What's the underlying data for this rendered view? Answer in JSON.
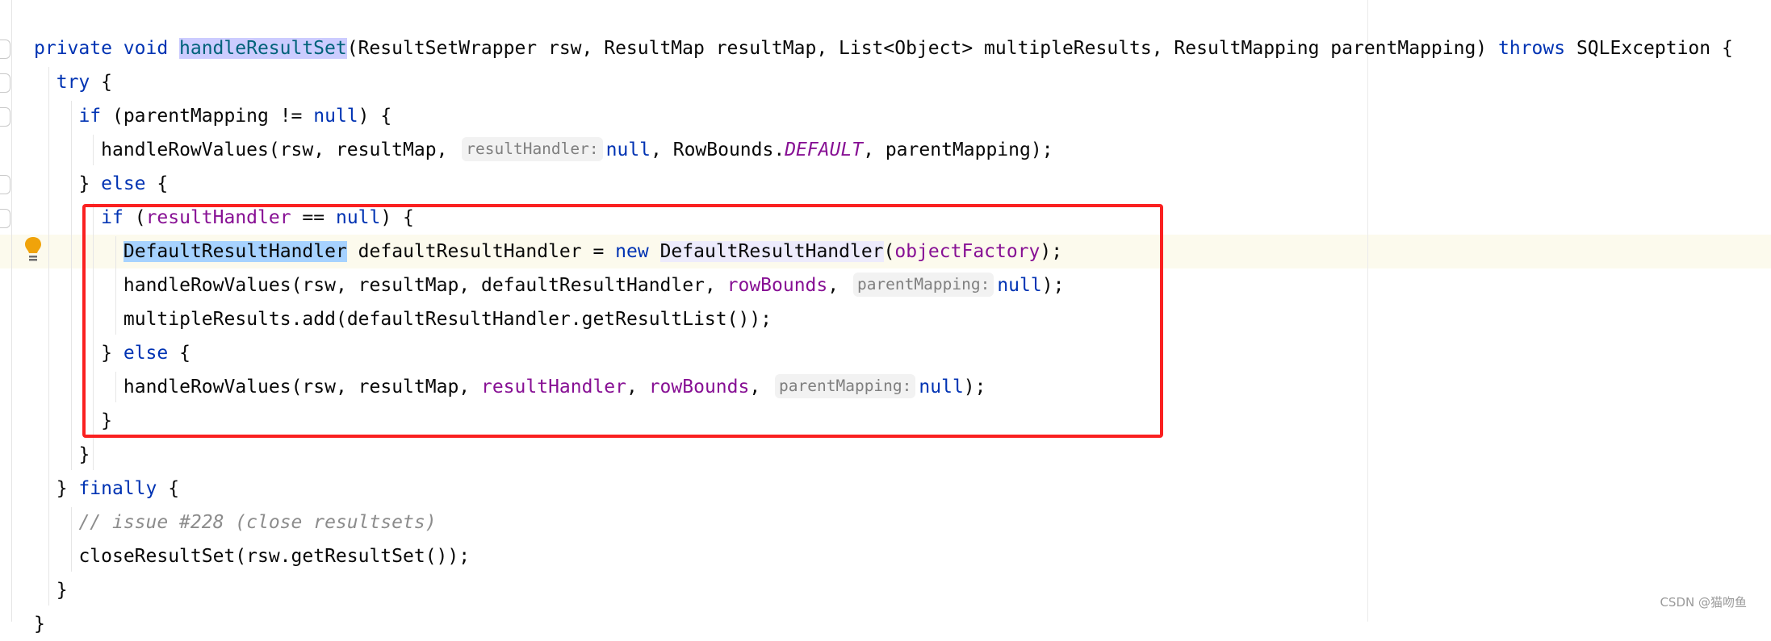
{
  "editor": {
    "lines": [
      {
        "indent": 0,
        "tokens": [
          {
            "t": "private void ",
            "c": "kw"
          },
          {
            "t": "handleResultSet",
            "c": "decl"
          },
          {
            "t": "(ResultSetWrapper rsw, ResultMap resultMap, List<Object> multipleResults, ResultMapping parentMapping) "
          },
          {
            "t": "throws",
            "c": "kw"
          },
          {
            "t": " SQLException {"
          }
        ]
      },
      {
        "indent": 1,
        "tokens": [
          {
            "t": "try",
            "c": "kw"
          },
          {
            "t": " {"
          }
        ]
      },
      {
        "indent": 2,
        "tokens": [
          {
            "t": "if",
            "c": "kw"
          },
          {
            "t": " (parentMapping != "
          },
          {
            "t": "null",
            "c": "kw"
          },
          {
            "t": ") {"
          }
        ]
      },
      {
        "indent": 3,
        "tokens": [
          {
            "t": "handleRowValues(rsw, resultMap, "
          },
          {
            "t": "resultHandler:",
            "c": "hint"
          },
          {
            "t": "null",
            "c": "kw"
          },
          {
            "t": ", RowBounds."
          },
          {
            "t": "DEFAULT",
            "c": "static"
          },
          {
            "t": ", parentMapping);"
          }
        ]
      },
      {
        "indent": 2,
        "tokens": [
          {
            "t": "} "
          },
          {
            "t": "else",
            "c": "kw"
          },
          {
            "t": " {"
          }
        ]
      },
      {
        "indent": 3,
        "tokens": [
          {
            "t": "if",
            "c": "kw"
          },
          {
            "t": " ("
          },
          {
            "t": "resultHandler",
            "c": "field"
          },
          {
            "t": " == "
          },
          {
            "t": "null",
            "c": "kw"
          },
          {
            "t": ") {"
          }
        ]
      },
      {
        "indent": 4,
        "tokens": [
          {
            "t": "DefaultResultHandler",
            "c": "sel"
          },
          {
            "t": " defaultResultHandler = "
          },
          {
            "t": "new",
            "c": "kw"
          },
          {
            "t": " "
          },
          {
            "t": "DefaultResultHandler",
            "c": "ref"
          },
          {
            "t": "("
          },
          {
            "t": "objectFactory",
            "c": "field"
          },
          {
            "t": ");"
          }
        ]
      },
      {
        "indent": 4,
        "tokens": [
          {
            "t": "handleRowValues(rsw, resultMap, defaultResultHandler, "
          },
          {
            "t": "rowBounds",
            "c": "field"
          },
          {
            "t": ", "
          },
          {
            "t": "parentMapping:",
            "c": "hint"
          },
          {
            "t": "null",
            "c": "kw"
          },
          {
            "t": ");"
          }
        ]
      },
      {
        "indent": 4,
        "tokens": [
          {
            "t": "multipleResults.add(defaultResultHandler.getResultList());"
          }
        ]
      },
      {
        "indent": 3,
        "tokens": [
          {
            "t": "} "
          },
          {
            "t": "else",
            "c": "kw"
          },
          {
            "t": " {"
          }
        ]
      },
      {
        "indent": 4,
        "tokens": [
          {
            "t": "handleRowValues(rsw, resultMap, "
          },
          {
            "t": "resultHandler",
            "c": "field"
          },
          {
            "t": ", "
          },
          {
            "t": "rowBounds",
            "c": "field"
          },
          {
            "t": ", "
          },
          {
            "t": "parentMapping:",
            "c": "hint"
          },
          {
            "t": "null",
            "c": "kw"
          },
          {
            "t": ");"
          }
        ]
      },
      {
        "indent": 3,
        "tokens": [
          {
            "t": "}"
          }
        ]
      },
      {
        "indent": 2,
        "tokens": [
          {
            "t": "}"
          }
        ]
      },
      {
        "indent": 1,
        "tokens": [
          {
            "t": "} "
          },
          {
            "t": "finally",
            "c": "kw"
          },
          {
            "t": " {"
          }
        ]
      },
      {
        "indent": 2,
        "tokens": [
          {
            "t": "// issue #228 (close resultsets)",
            "c": "comment"
          }
        ]
      },
      {
        "indent": 2,
        "tokens": [
          {
            "t": "closeResultSet(rsw.getResultSet());"
          }
        ]
      },
      {
        "indent": 1,
        "tokens": [
          {
            "t": "}"
          }
        ]
      },
      {
        "indent": 0,
        "tokens": [
          {
            "t": "}"
          }
        ]
      }
    ],
    "caret_line": 7,
    "gutter_icon": "intention-bulb-icon",
    "annotation_color": "#fa2020"
  },
  "watermark": "CSDN @猫吻鱼"
}
